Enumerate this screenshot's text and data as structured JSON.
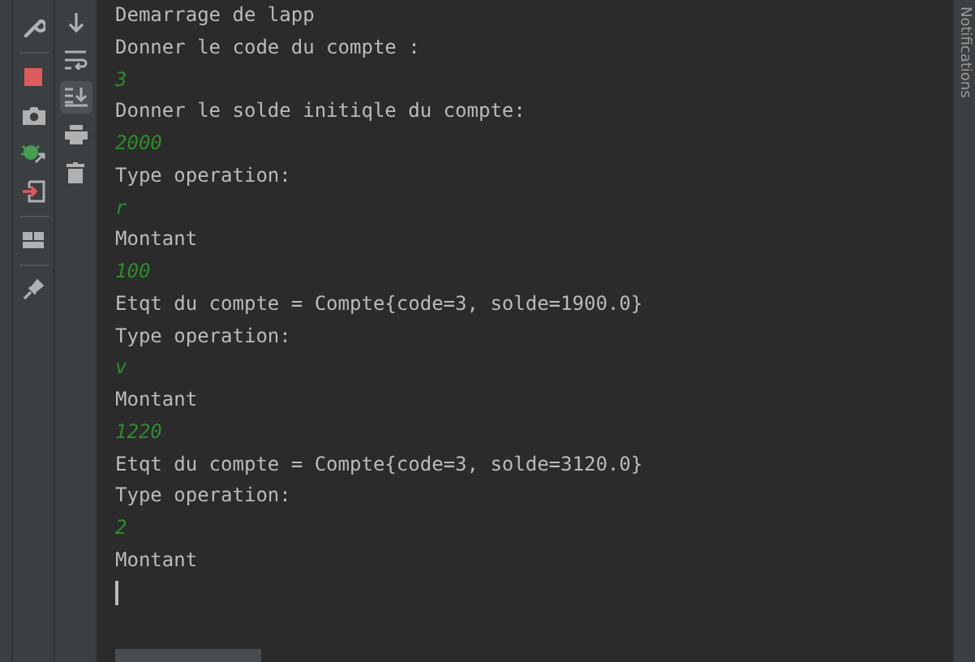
{
  "left_toolbar": [
    {
      "kind": "wrench"
    },
    {
      "kind": "divider"
    },
    {
      "kind": "stop"
    },
    {
      "kind": "camera"
    },
    {
      "kind": "debug"
    },
    {
      "kind": "exit"
    },
    {
      "kind": "divider"
    },
    {
      "kind": "layout"
    },
    {
      "kind": "divider"
    },
    {
      "kind": "pin"
    }
  ],
  "console_toolbar": [
    {
      "kind": "down",
      "on": false
    },
    {
      "kind": "wrap",
      "on": false
    },
    {
      "kind": "scroll-end",
      "on": true
    },
    {
      "kind": "print",
      "on": false
    },
    {
      "kind": "trash",
      "on": false
    }
  ],
  "console_lines": [
    {
      "kind": "output",
      "text": "Demarrage de lapp"
    },
    {
      "kind": "output",
      "text": "Donner le code du compte :"
    },
    {
      "kind": "input",
      "text": "3"
    },
    {
      "kind": "output",
      "text": "Donner le solde initiqle du compte:"
    },
    {
      "kind": "input",
      "text": "2000"
    },
    {
      "kind": "output",
      "text": "Type operation:"
    },
    {
      "kind": "input",
      "text": "r"
    },
    {
      "kind": "output",
      "text": "Montant"
    },
    {
      "kind": "input",
      "text": "100"
    },
    {
      "kind": "output",
      "text": "Etqt du compte = Compte{code=3, solde=1900.0}"
    },
    {
      "kind": "output",
      "text": "Type operation:"
    },
    {
      "kind": "input",
      "text": "v"
    },
    {
      "kind": "output",
      "text": "Montant"
    },
    {
      "kind": "input",
      "text": "1220"
    },
    {
      "kind": "output",
      "text": "Etqt du compte = Compte{code=3, solde=3120.0}"
    },
    {
      "kind": "output",
      "text": "Type operation:"
    },
    {
      "kind": "input",
      "text": "2"
    },
    {
      "kind": "output",
      "text": "Montant"
    }
  ],
  "right_stripe": {
    "label": "Notifications"
  }
}
